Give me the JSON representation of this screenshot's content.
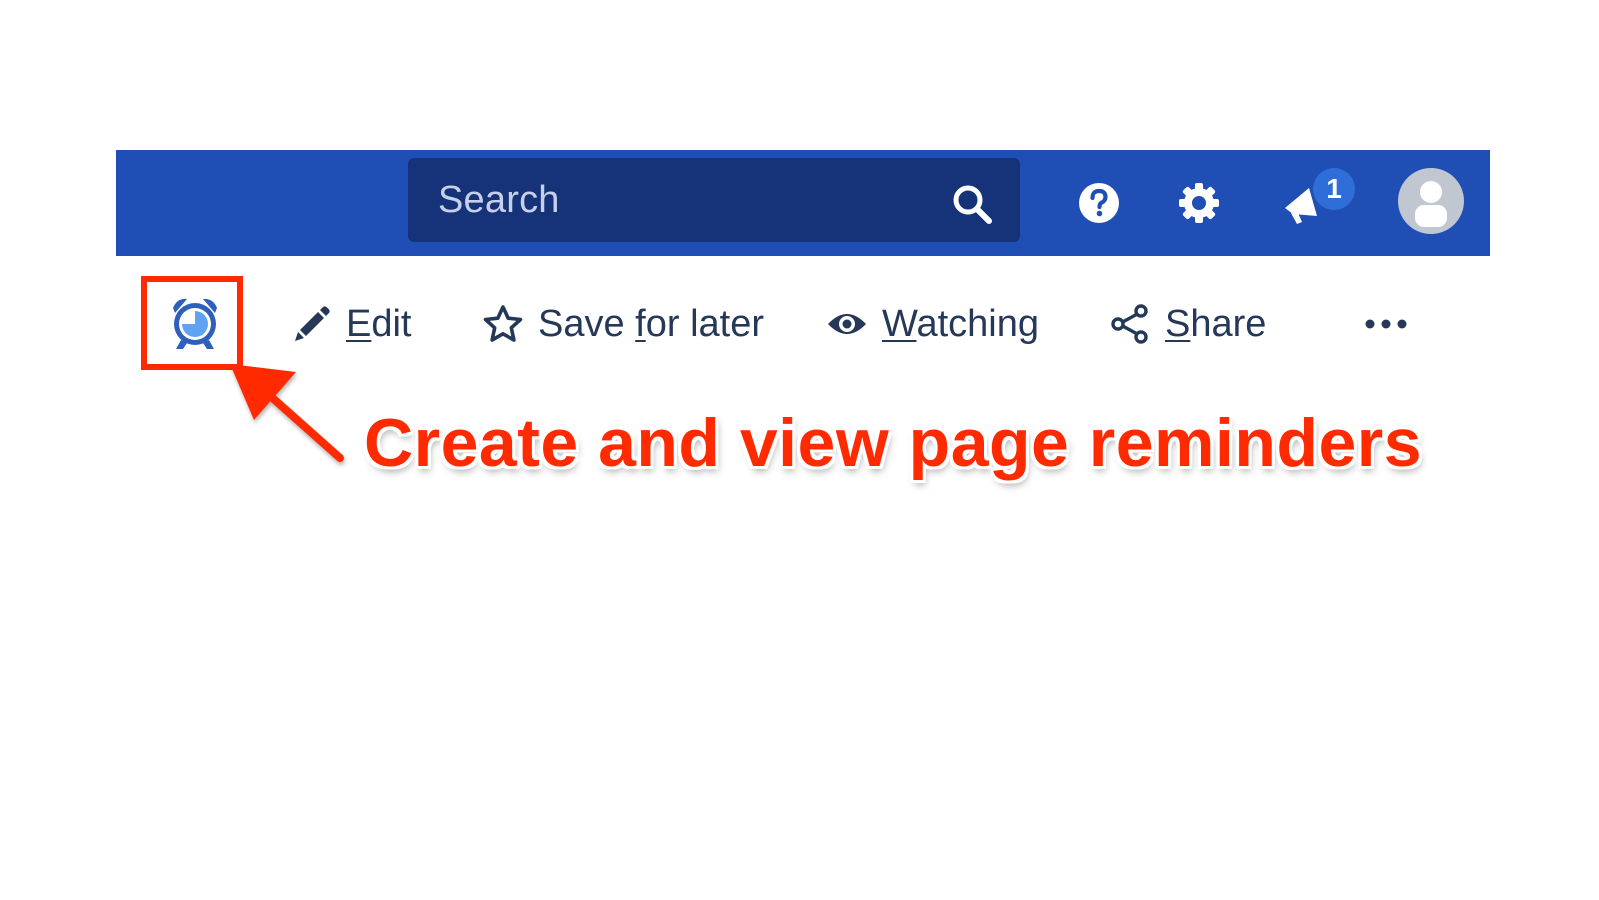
{
  "colors": {
    "header_bg": "#1f4fb5",
    "search_bg": "#16337a",
    "toolbar_text": "#253858",
    "icon_blue": "#2d5fbd",
    "reminder_light": "#5fa3f0",
    "badge_bg": "#2f6ed8",
    "annotation_red": "#ff2a00"
  },
  "header": {
    "search": {
      "placeholder": "Search",
      "icon": "search-icon"
    },
    "icons": [
      "help-icon",
      "gear-icon",
      "megaphone-icon",
      "avatar"
    ],
    "notification_count": "1"
  },
  "toolbar": {
    "reminder": {
      "icon": "alarm-clock-icon"
    },
    "edit": {
      "icon": "pencil-icon",
      "label_u": "E",
      "label_rest": "dit"
    },
    "save": {
      "icon": "star-icon",
      "label_a": "Save ",
      "label_u": "f",
      "label_b": "or later"
    },
    "watch": {
      "icon": "eye-icon",
      "label_u": "W",
      "label_rest": "atching"
    },
    "share": {
      "icon": "share-icon",
      "label_u": "S",
      "label_rest": "hare"
    },
    "more": {
      "icon": "more-icon"
    }
  },
  "annotation": {
    "text": "Create and view page reminders"
  }
}
